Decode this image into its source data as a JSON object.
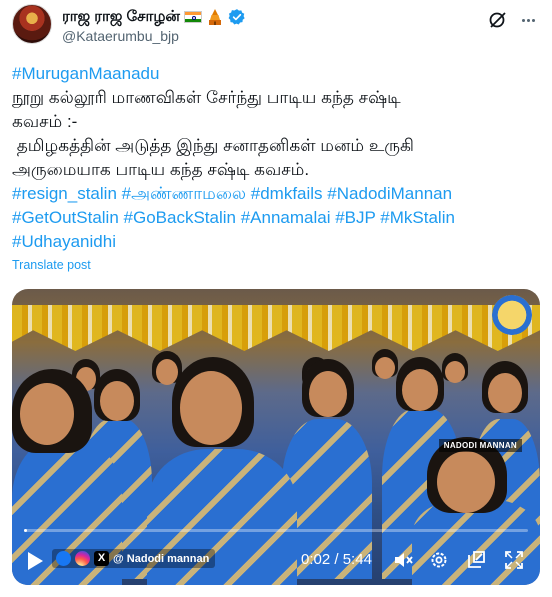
{
  "author": {
    "display_name": "ராஜ ராஜ சோழன்",
    "handle": "@Kataerumbu_bjp",
    "badges": [
      "india-flag-icon",
      "temple-icon",
      "verified-badge-icon"
    ],
    "verified_color": "#1d9bf0"
  },
  "tweet": {
    "lines": [
      "#MuruganMaanadu",
      "நூறு கல்லூரி மாணவிகள் சேர்ந்து பாடிய கந்த சஷ்டி",
      "கவசம் :-",
      " தமிழகத்தின் அடுத்த இந்து சனாதனிகள் மனம் உருகி",
      "அருமையாக பாடிய கந்த சஷ்டி கவசம்."
    ],
    "hashtag_lines": [
      [
        "#resign_stalin",
        "#அண்ணாமலை",
        "#dmkfails",
        "#NadodiMannan"
      ],
      [
        "#GetOutStalin",
        "#GoBackStalin",
        "#Annamalai",
        "#BJP",
        "#MkStalin"
      ],
      [
        "#Udhayanidhi"
      ]
    ],
    "translate_label": "Translate post"
  },
  "video": {
    "watermark_text": "NADODI MANNAN",
    "social_label": "@ Nadodi mannan",
    "current_time": "0:02",
    "separator": " / ",
    "duration": "5:44",
    "progress_fraction": 0.006
  },
  "colors": {
    "link": "#1d9bf0",
    "text": "#0f1419",
    "secondary": "#536471"
  }
}
